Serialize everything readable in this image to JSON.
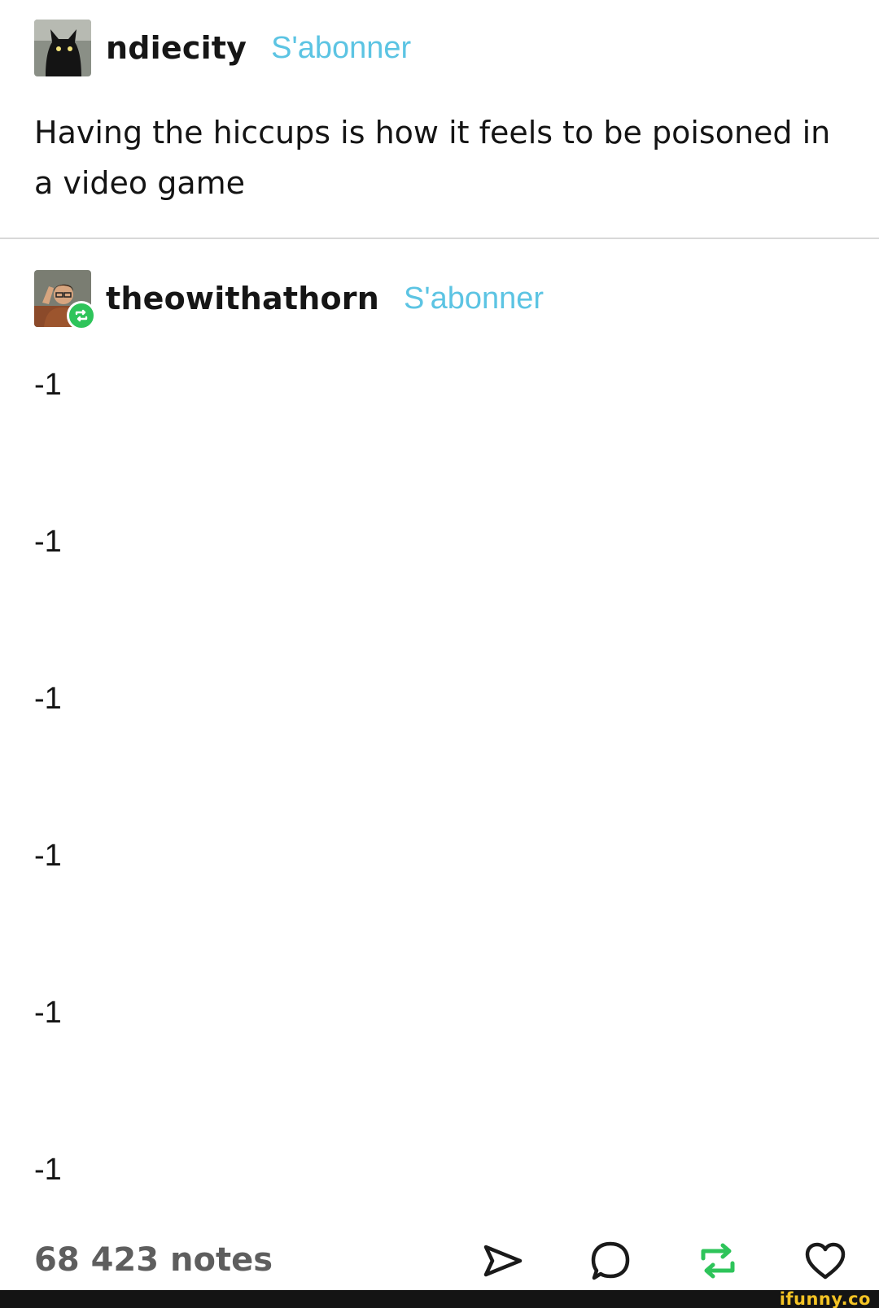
{
  "posts": [
    {
      "username": "ndiecity",
      "follow_label": "S'abonner",
      "avatar_icon": "black-cat-avatar",
      "text": "Having the hiccups is how it feels to be poisoned in a video game"
    },
    {
      "username": "theowithathorn",
      "follow_label": "S'abonner",
      "avatar_icon": "person-avatar",
      "badge_icon": "reblog-icon",
      "replies": [
        "-1",
        "-1",
        "-1",
        "-1",
        "-1",
        "-1"
      ]
    }
  ],
  "footer": {
    "notes": "68 423 notes",
    "actions": [
      "share-icon",
      "reply-icon",
      "reblog-icon",
      "like-icon"
    ]
  },
  "colors": {
    "follow": "#5cc4e3",
    "reblog_green": "#2ec45a",
    "watermark": "#f3c324"
  },
  "watermark": "ifunny.co"
}
